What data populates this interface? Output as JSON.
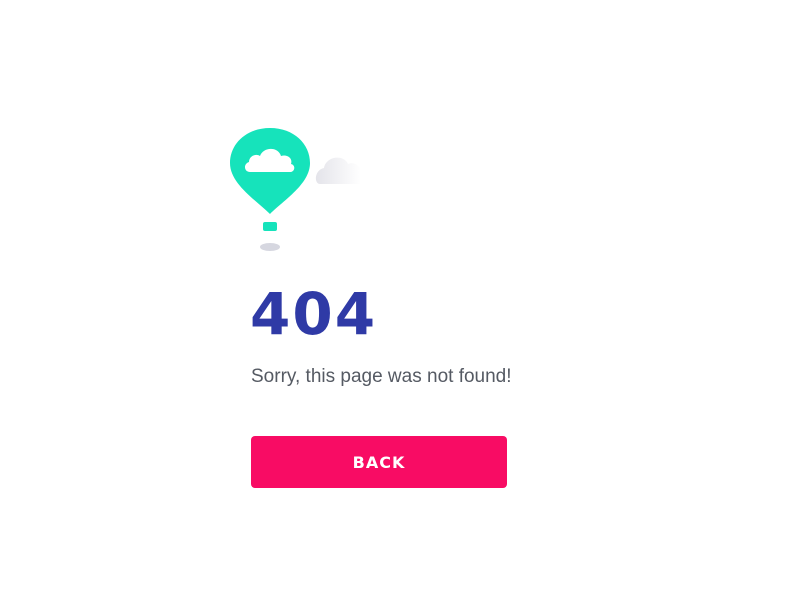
{
  "illustration": {
    "balloon_icon": "hot-air-balloon-icon",
    "cloud_icon": "cloud-icon",
    "colors": {
      "balloon": "#16e3bb",
      "cloud_inner": "#ffffff",
      "background_cloud": "#ebebef",
      "shadow": "#d6d7e0"
    }
  },
  "error": {
    "code": "404",
    "message": "Sorry, this page was not found!",
    "color": "#2f3aa6"
  },
  "actions": {
    "back_label": "BACK",
    "back_color": "#f80c64"
  }
}
